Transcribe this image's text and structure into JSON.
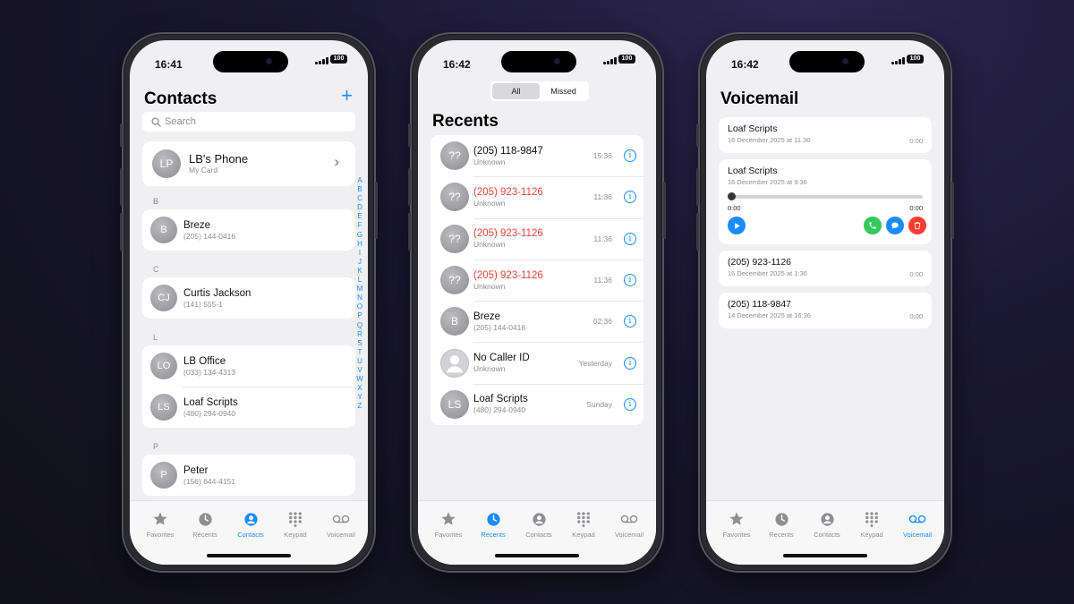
{
  "tabs": [
    {
      "label": "Favorites",
      "icon": "star-icon"
    },
    {
      "label": "Recents",
      "icon": "clock-icon"
    },
    {
      "label": "Contacts",
      "icon": "person-circle-icon"
    },
    {
      "label": "Keypad",
      "icon": "keypad-icon"
    },
    {
      "label": "Voicemail",
      "icon": "voicemail-icon"
    }
  ],
  "accent": "#1a8cff",
  "missed_color": "#e5453d",
  "contacts_screen": {
    "status": {
      "time": "16:41",
      "battery": "100"
    },
    "title": "Contacts",
    "add_icon": "+",
    "search_placeholder": "Search",
    "my_card": {
      "initials": "LP",
      "name": "LB's Phone",
      "sub": "My Card"
    },
    "sections": [
      {
        "letter": "B",
        "contacts": [
          {
            "initials": "B",
            "name": "Breze",
            "phone": "(205) 144-0416"
          }
        ]
      },
      {
        "letter": "C",
        "contacts": [
          {
            "initials": "CJ",
            "name": "Curtis Jackson",
            "phone": "(141) 555-1"
          }
        ]
      },
      {
        "letter": "L",
        "contacts": [
          {
            "initials": "LO",
            "name": "LB Office",
            "phone": "(033) 134-4313"
          },
          {
            "initials": "LS",
            "name": "Loaf Scripts",
            "phone": "(480) 294-0940"
          }
        ]
      },
      {
        "letter": "P",
        "contacts": [
          {
            "initials": "P",
            "name": "Peter",
            "phone": "(156) 644-4151"
          }
        ]
      }
    ],
    "alphabet": [
      "A",
      "B",
      "C",
      "D",
      "E",
      "F",
      "G",
      "H",
      "I",
      "J",
      "K",
      "L",
      "M",
      "N",
      "O",
      "P",
      "Q",
      "R",
      "S",
      "T",
      "U",
      "V",
      "W",
      "X",
      "Y",
      "Z"
    ],
    "active_tab": "Contacts"
  },
  "recents_screen": {
    "status": {
      "time": "16:42",
      "battery": "100"
    },
    "segments": [
      "All",
      "Missed"
    ],
    "selected_segment": "All",
    "title": "Recents",
    "calls": [
      {
        "initials": "??",
        "name": "(205) 118-9847",
        "sub": "Unknown",
        "time": "15:36",
        "missed": false
      },
      {
        "initials": "??",
        "name": "(205) 923-1126",
        "sub": "Unknown",
        "time": "11:36",
        "missed": true
      },
      {
        "initials": "??",
        "name": "(205) 923-1126",
        "sub": "Unknown",
        "time": "11:36",
        "missed": true
      },
      {
        "initials": "??",
        "name": "(205) 923-1126",
        "sub": "Unknown",
        "time": "11:36",
        "missed": true
      },
      {
        "initials": "B",
        "name": "Breze",
        "sub": "(205) 144-0416",
        "time": "02:36",
        "missed": false
      },
      {
        "initials": "",
        "name": "No Caller ID",
        "sub": "Unknown",
        "time": "Yesterday",
        "missed": false
      },
      {
        "initials": "LS",
        "name": "Loaf Scripts",
        "sub": "(480) 294-0940",
        "time": "Sunday",
        "missed": false
      }
    ],
    "active_tab": "Recents"
  },
  "voicemail_screen": {
    "status": {
      "time": "16:42",
      "battery": "100"
    },
    "title": "Voicemail",
    "messages": [
      {
        "name": "Loaf Scripts",
        "date": "16 December 2025 at 11:36",
        "duration": "0:00"
      },
      {
        "name": "Loaf Scripts",
        "date": "16 December 2025 at 9:36",
        "elapsed": "0:00",
        "remaining": "0:00",
        "progress": 0
      },
      {
        "name": "(205) 923-1126",
        "date": "16 December 2025 at 1:36",
        "duration": "0:00"
      },
      {
        "name": "(205) 118-9847",
        "date": "14 December 2025 at 16:36",
        "duration": "0:00"
      }
    ],
    "active_tab": "Voicemail"
  }
}
